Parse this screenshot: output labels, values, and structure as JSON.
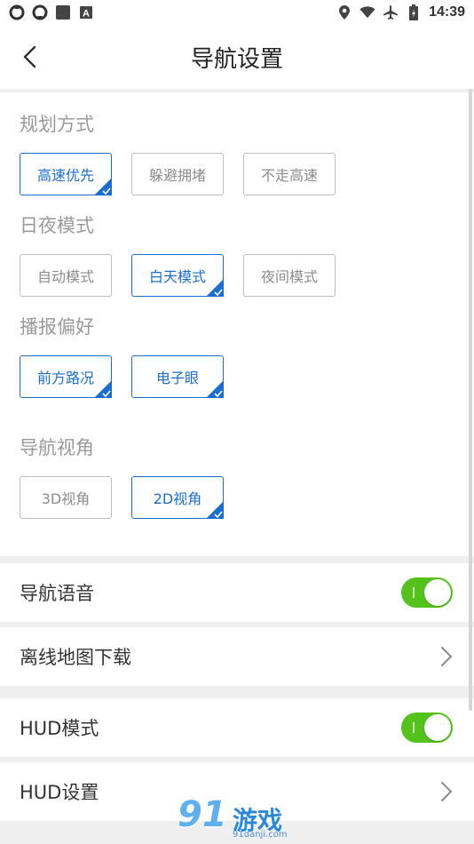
{
  "status_bar": {
    "time": "14:39",
    "left_icons": [
      "sync-icon",
      "sync-icon",
      "square-icon",
      "a-badge-icon"
    ],
    "right_icons": [
      "location-icon",
      "wifi-icon",
      "airplane-icon",
      "battery-icon"
    ]
  },
  "header": {
    "title": "导航设置"
  },
  "sections": {
    "route": {
      "title": "规划方式",
      "options": [
        "高速优先",
        "躲避拥堵",
        "不走高速"
      ],
      "selected": [
        0
      ]
    },
    "day_night": {
      "title": "日夜模式",
      "options": [
        "自动模式",
        "白天模式",
        "夜间模式"
      ],
      "selected": [
        1
      ]
    },
    "broadcast": {
      "title": "播报偏好",
      "options": [
        "前方路况",
        "电子眼"
      ],
      "selected": [
        0,
        1
      ]
    },
    "view": {
      "title": "导航视角",
      "options": [
        "3D视角",
        "2D视角"
      ],
      "selected": [
        1
      ]
    }
  },
  "rows": {
    "voice": {
      "label": "导航语音",
      "on": true
    },
    "offline_map": {
      "label": "离线地图下载"
    },
    "hud_mode": {
      "label": "HUD模式",
      "on": true
    },
    "hud_settings": {
      "label": "HUD设置"
    }
  },
  "colors": {
    "accent": "#1b6ed1",
    "toggle_on": "#53c31b",
    "page_bg": "#efefef"
  },
  "watermark": {
    "number": "91",
    "name": "游戏",
    "url": "91danji.com"
  }
}
